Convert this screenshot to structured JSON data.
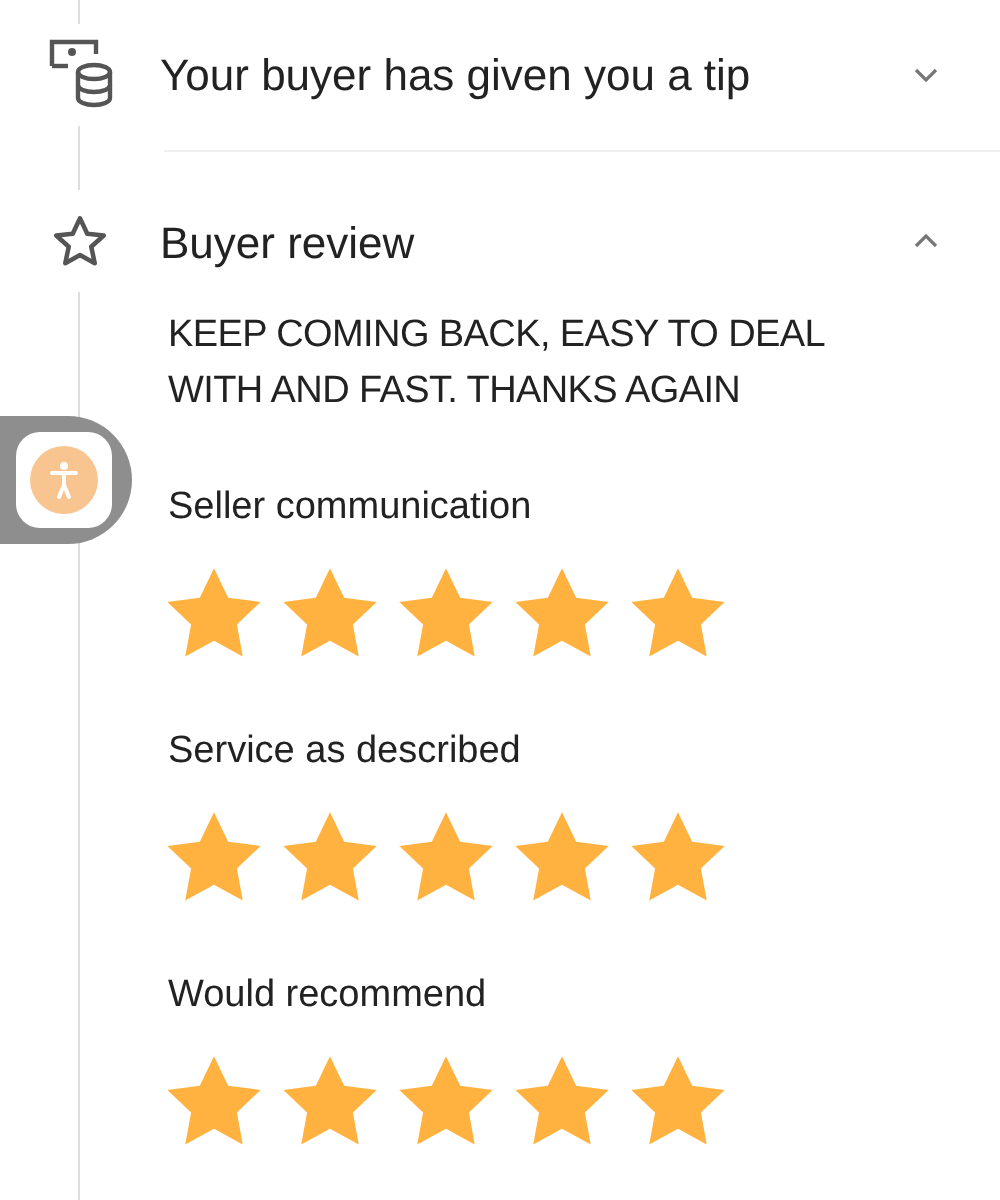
{
  "sections": [
    {
      "kind": "tip",
      "title": "Your buyer has given you a tip",
      "expanded": false
    },
    {
      "kind": "review",
      "title": "Buyer review",
      "expanded": true,
      "review_text": "KEEP COMING BACK, EASY TO DEAL WITH AND FAST. THANKS AGAIN",
      "ratings": [
        {
          "label": "Seller communication",
          "stars": 5
        },
        {
          "label": "Service as described",
          "stars": 5
        },
        {
          "label": "Would recommend",
          "stars": 5
        }
      ]
    }
  ]
}
